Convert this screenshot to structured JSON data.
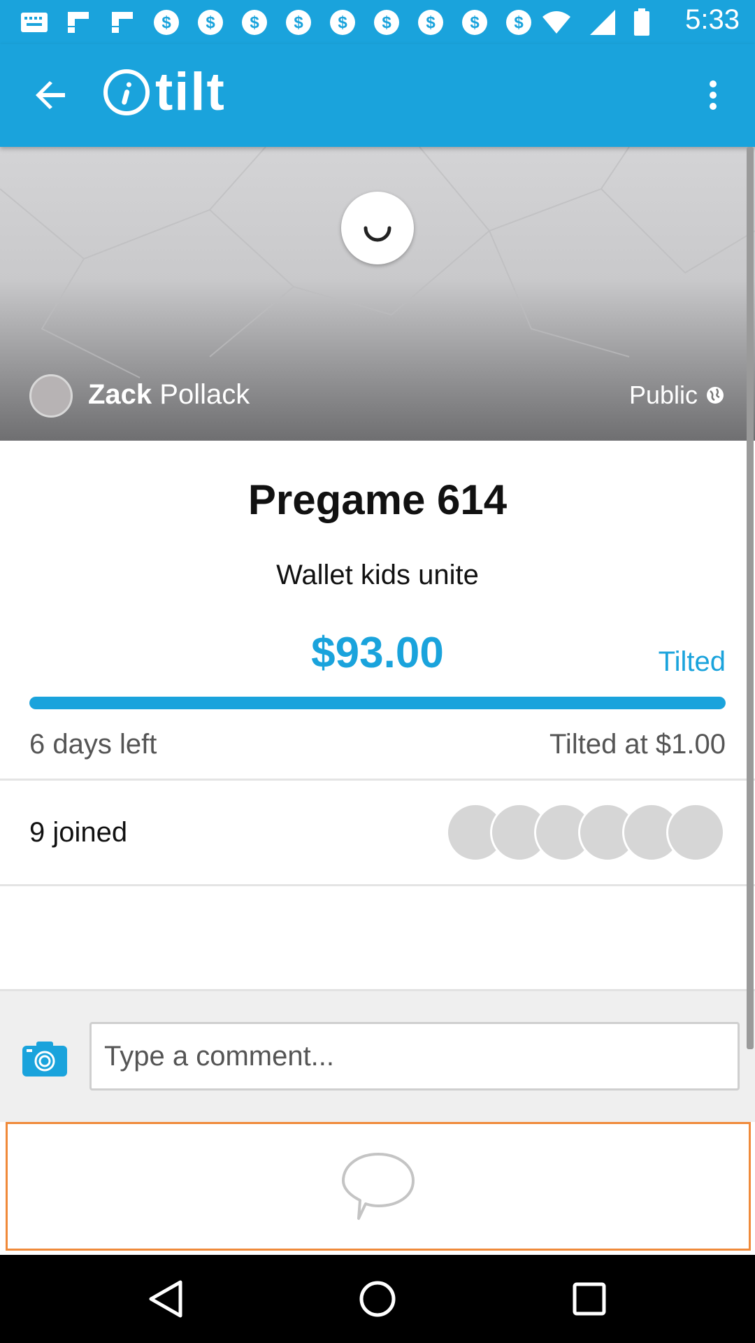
{
  "status_bar": {
    "time": "5:33",
    "notification_icons": [
      "notification-icon",
      "flipboard-icon",
      "flipboard-icon",
      "dollar-icon",
      "dollar-icon",
      "dollar-icon",
      "dollar-icon",
      "dollar-icon",
      "dollar-icon",
      "dollar-icon",
      "dollar-icon",
      "dollar-icon"
    ]
  },
  "app_bar": {
    "logo_text": "tilt",
    "back_icon": "arrow-back-icon",
    "menu_icon": "more-vert-icon"
  },
  "banner": {
    "owner_first": "Zack",
    "owner_last": "Pollack",
    "privacy": "Public",
    "privacy_icon": "globe-icon"
  },
  "campaign": {
    "title": "Pregame 614",
    "description": "Wallet kids unite",
    "amount": "$93.00",
    "status": "Tilted",
    "progress_fraction": 1.0,
    "days_left": "6 days left",
    "tilted_at": "Tilted at $1.00",
    "joined": "9 joined",
    "member_avatar_count": 6
  },
  "comments": {
    "placeholder": "Type a comment..."
  },
  "colors": {
    "brand": "#1aa3dc",
    "empty_border": "#f08a3a"
  }
}
